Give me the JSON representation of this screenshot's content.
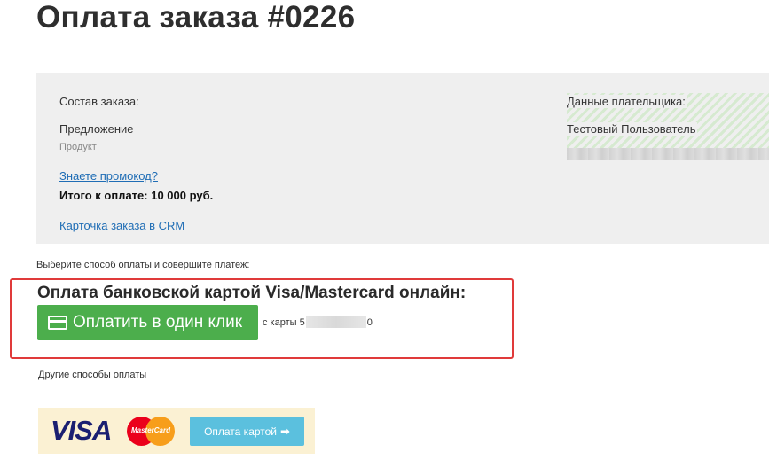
{
  "header": {
    "title": "Оплата заказа #0226"
  },
  "order": {
    "composition_label": "Состав заказа:",
    "offer_label": "Предложение",
    "product_label": "Продукт",
    "promo_link": "Знаете промокод?",
    "total": "Итого к оплате: 10 000 руб.",
    "crm_link": "Карточка заказа в CRM"
  },
  "payer": {
    "label": "Данные плательщика:",
    "name": "Тестовый Пользователь"
  },
  "payment": {
    "choose_text": "Выберите способ оплаты и совершите платеж:",
    "card_heading": "Оплата банковской картой Visa/Mastercard онлайн:",
    "one_click_label": "Оплатить в один клик",
    "card_from_prefix": "с карты 5",
    "card_from_suffix": "0",
    "other_methods": "Другие способы оплаты",
    "visa_label": "VISA",
    "mastercard_label": "MasterCard",
    "pay_card_label": "Оплата картой",
    "pay_card_arrow": "➡",
    "icons": [
      "credit-card-icon",
      "arrow-right-icon"
    ]
  },
  "colors": {
    "primary_button": "#4cae4c",
    "secondary_button": "#5bc0de",
    "highlight_border": "#e03a3a",
    "link": "#1f6db5"
  }
}
